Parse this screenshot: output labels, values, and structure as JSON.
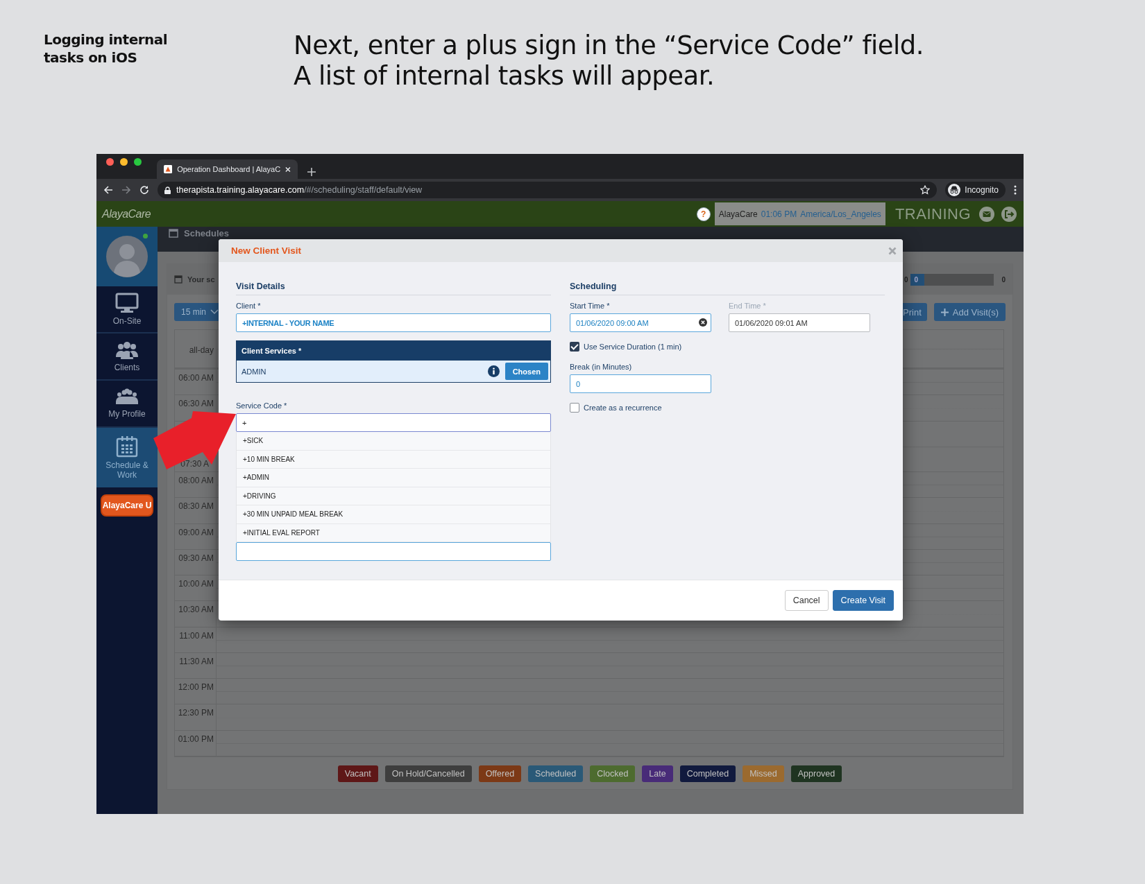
{
  "slide": {
    "section_title": "Logging internal tasks on iOS",
    "instruction": [
      "Next, enter a plus sign in the “Service Code” field.",
      "A list of internal tasks will appear."
    ]
  },
  "browser": {
    "tab_title": "Operation Dashboard | AlayaC",
    "url_host": "therapista.training.alayacare.com",
    "url_path": "/#/scheduling/staff/default/view",
    "profile_label": "Incognito"
  },
  "app_header": {
    "logo": "AlayaCare",
    "help": "?",
    "org": "AlayaCare",
    "time": "01:06 PM",
    "timezone": "America/Los_Angeles",
    "environment": "TRAINING"
  },
  "sidebar": {
    "items": [
      {
        "label": "On-Site",
        "kind": "monitor",
        "selected": false
      },
      {
        "label": "Clients",
        "kind": "people",
        "selected": false
      },
      {
        "label": "My Profile",
        "kind": "team",
        "selected": false
      },
      {
        "label": "Schedule & Work",
        "kind": "calendar",
        "selected": true
      }
    ],
    "academy_button": "AlayaCare U"
  },
  "page": {
    "title": "Schedules",
    "panel_title": "Your sc",
    "counts": [
      "0",
      "0",
      "0"
    ],
    "progress": {
      "level": 0.16
    },
    "interval": "15 min",
    "buttons": [
      "Print",
      "Add Visit(s)"
    ],
    "all_day_label": "all-day",
    "time_rows": [
      "06:00 AM",
      "06:30 AM",
      "07:30 A",
      "08:00 AM",
      "08:30 AM",
      "09:00 AM",
      "09:30 AM",
      "10:00 AM",
      "10:30 AM",
      "11:00 AM",
      "11:30 AM",
      "12:00 PM",
      "12:30 PM",
      "01:00 PM"
    ],
    "legend": [
      {
        "label": "Vacant",
        "color": "#5e1717"
      },
      {
        "label": "On Hold/Cancelled",
        "color": "#3e3e3e"
      },
      {
        "label": "Offered",
        "color": "#7c3916"
      },
      {
        "label": "Scheduled",
        "color": "#2a5977"
      },
      {
        "label": "Clocked",
        "color": "#4d6b2f"
      },
      {
        "label": "Late",
        "color": "#482b78"
      },
      {
        "label": "Completed",
        "color": "#111a3e"
      },
      {
        "label": "Missed",
        "color": "#9b6a2f"
      },
      {
        "label": "Approved",
        "color": "#1f3421"
      }
    ]
  },
  "modal": {
    "title": "New Client Visit",
    "visit_details": {
      "heading": "Visit Details",
      "client_label": "Client *",
      "client_value": "+INTERNAL - YOUR NAME",
      "services_header": "Client Services *",
      "services": [
        {
          "name": "ADMIN",
          "button": "Chosen"
        }
      ],
      "service_code_label": "Service Code *",
      "service_code_value": "+",
      "suggestions": [
        "+SICK",
        "+10 MIN BREAK",
        "+ADMIN",
        "+DRIVING",
        "+30 MIN UNPAID MEAL BREAK",
        "+INITIAL EVAL REPORT"
      ]
    },
    "scheduling": {
      "heading": "Scheduling",
      "start_label": "Start Time *",
      "start_value": "01/06/2020 09:00 AM",
      "end_label": "End Time *",
      "end_value": "01/06/2020 09:01 AM",
      "end_disabled": true,
      "use_duration": {
        "label": "Use Service Duration (1 min)",
        "checked": true
      },
      "break_label": "Break (in Minutes)",
      "break_value": "0",
      "recurrence": {
        "label": "Create as a recurrence",
        "checked": false
      }
    },
    "buttons": [
      {
        "label": "Cancel",
        "kind": "secondary"
      },
      {
        "label": "Create Visit",
        "kind": "primary"
      }
    ]
  }
}
